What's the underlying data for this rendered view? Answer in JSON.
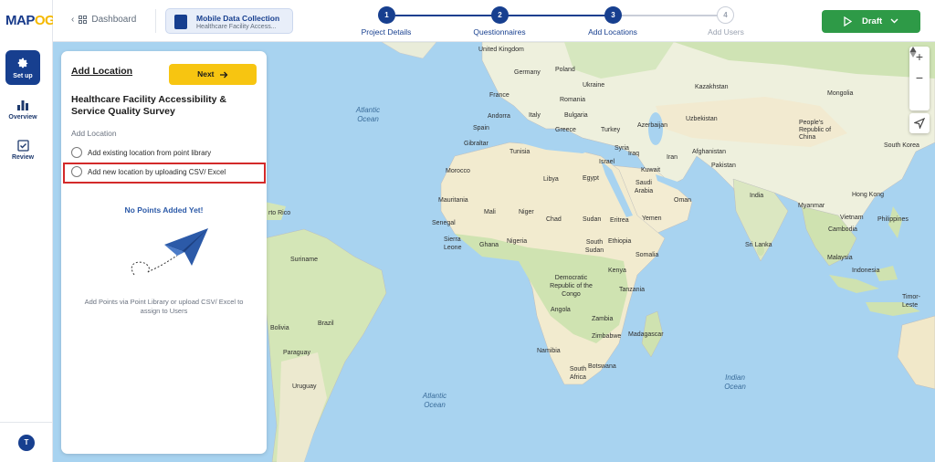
{
  "brand": {
    "logo_main": "MAP",
    "logo_accent": "OG"
  },
  "sidebar": {
    "items": [
      {
        "label": "Set up",
        "icon": "gear-icon",
        "active": true
      },
      {
        "label": "Overview",
        "icon": "bar-chart-icon",
        "active": false
      },
      {
        "label": "Review",
        "icon": "checkbox-icon",
        "active": false
      }
    ],
    "avatar_initial": "T"
  },
  "topbar": {
    "back_label": "Dashboard",
    "project": {
      "name": "Mobile Data Collection",
      "subtitle": "Healthcare Facility Access..."
    },
    "steps": [
      {
        "number": "1",
        "label": "Project Details",
        "state": "done"
      },
      {
        "number": "2",
        "label": "Questionnaires",
        "state": "done"
      },
      {
        "number": "3",
        "label": "Add Locations",
        "state": "current"
      },
      {
        "number": "4",
        "label": "Add Users",
        "state": "todo"
      }
    ],
    "draft_label": "Draft"
  },
  "panel": {
    "title": "Add Location",
    "next_label": "Next",
    "survey_title": "Healthcare Facility Accessibility & Service Quality Survey",
    "section_label": "Add Location",
    "options": [
      "Add existing location from point library",
      "Add new location by uploading CSV/ Excel"
    ],
    "empty_title": "No Points Added Yet!",
    "empty_help": "Add Points via Point Library or upload CSV/ Excel to assign to Users"
  },
  "map": {
    "zoom_in": "+",
    "zoom_out": "−",
    "labels": {
      "united_kingdom": "United Kingdom",
      "germany": "Germany",
      "poland": "Poland",
      "ukraine": "Ukraine",
      "kazakhstan": "Kazakhstan",
      "mongolia": "Mongolia",
      "france": "France",
      "romania": "Romania",
      "andorra": "Andorra",
      "italy": "Italy",
      "bulgaria": "Bulgaria",
      "uzbekistan": "Uzbekistan",
      "azerbaijan": "Azerbaijan",
      "spain": "Spain",
      "greece": "Greece",
      "turkey": "Turkey",
      "china": "People's Republic of China",
      "south_korea": "South Korea",
      "gibraltar": "Gibraltar",
      "tunisia": "Tunisia",
      "syria": "Syria",
      "afghanistan": "Afghanistan",
      "iraq": "Iraq",
      "iran": "Iran",
      "israel": "Israel",
      "kuwait": "Kuwait",
      "pakistan": "Pakistan",
      "morocco": "Morocco",
      "libya": "Libya",
      "egypt": "Egypt",
      "saudi_arabia": "Saudi Arabia",
      "oman": "Oman",
      "india": "India",
      "hong_kong": "Hong Kong",
      "mauritania": "Mauritania",
      "mali": "Mali",
      "niger": "Niger",
      "myanmar": "Myanmar",
      "chad": "Chad",
      "sudan": "Sudan",
      "eritrea": "Eritrea",
      "yemen": "Yemen",
      "vietnam": "Vietnam",
      "philippines": "Philippines",
      "senegal": "Senegal",
      "cambodia": "Cambodia",
      "sierra_leone": "Sierra Leone",
      "ghana": "Ghana",
      "nigeria": "Nigeria",
      "south_sudan": "South Sudan",
      "ethiopia": "Ethiopia",
      "somalia": "Somalia",
      "sri_lanka": "Sri Lanka",
      "malaysia": "Malaysia",
      "kenya": "Kenya",
      "indonesia": "Indonesia",
      "drc": "Democratic Republic of the Congo",
      "tanzania": "Tanzania",
      "timor_leste": "Timor-Leste",
      "angola": "Angola",
      "zambia": "Zambia",
      "zimbabwe": "Zimbabwe",
      "madagascar": "Madagascar",
      "namibia": "Namibia",
      "botswana": "Botswana",
      "south_africa": "South Africa",
      "suriname": "Suriname",
      "brazil": "Brazil",
      "bolivia": "Bolivia",
      "paraguay": "Paraguay",
      "uruguay": "Uruguay",
      "puerto_rico": "rto Rico",
      "atlantic_north": "Atlantic Ocean",
      "atlantic_south": "Atlantic Ocean",
      "indian_ocean": "Indian Ocean"
    }
  }
}
